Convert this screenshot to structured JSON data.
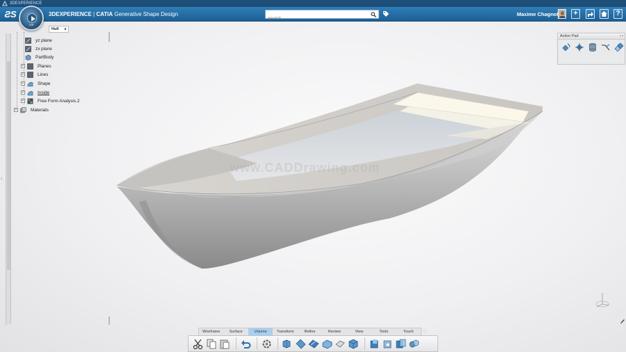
{
  "titlebar": {
    "text": "3DEXPERIENCE"
  },
  "header": {
    "brand": "3DEXPERIENCE",
    "separator": " | ",
    "product": "CATIA",
    "app": " Generative Shape Design",
    "compass_label": "V.R",
    "search_placeholder": "Search",
    "user": "Maxime Chagnot",
    "buttons": [
      "+",
      "share",
      "home",
      "?"
    ]
  },
  "doc_tab": {
    "label": "Hull",
    "close": "x"
  },
  "tree": {
    "items": [
      {
        "label": "yz plane",
        "icon": "plane-icon"
      },
      {
        "label": "zx plane",
        "icon": "plane-icon"
      },
      {
        "label": "PartBody",
        "icon": "body-icon"
      },
      {
        "label": "Planes",
        "icon": "plane-icon",
        "expandable": true
      },
      {
        "label": "Lines",
        "icon": "plane-icon",
        "expandable": true
      },
      {
        "label": "Shape",
        "icon": "shape-icon",
        "expandable": true
      },
      {
        "label": "Inside",
        "icon": "shape-icon",
        "expandable": true,
        "underline": true
      },
      {
        "label": "Free Form Analysis.2",
        "icon": "analysis-icon",
        "expandable": true
      },
      {
        "label": "Materials",
        "icon": "materials-icon",
        "expandable": true
      }
    ]
  },
  "action_pad": {
    "title": "Action Pad",
    "icons": [
      "rotate-icon",
      "translate-icon",
      "stack-icon",
      "measure-icon",
      "manipulator-icon"
    ]
  },
  "watermark": "www.CADDrawing.com",
  "tabs": [
    {
      "label": "Wireframe",
      "active": false
    },
    {
      "label": "Surface",
      "active": false
    },
    {
      "label": "Volume",
      "active": true
    },
    {
      "label": "Transform",
      "active": false
    },
    {
      "label": "Refine",
      "active": false
    },
    {
      "label": "Review",
      "active": false
    },
    {
      "label": "View",
      "active": false
    },
    {
      "label": "Tools",
      "active": false
    },
    {
      "label": "Touch",
      "active": false
    }
  ],
  "colors": {
    "header": "#2a72aa",
    "active_tab": "#a9cfee",
    "hull": "#c9c9c9",
    "deck": "#fbf7ea"
  }
}
